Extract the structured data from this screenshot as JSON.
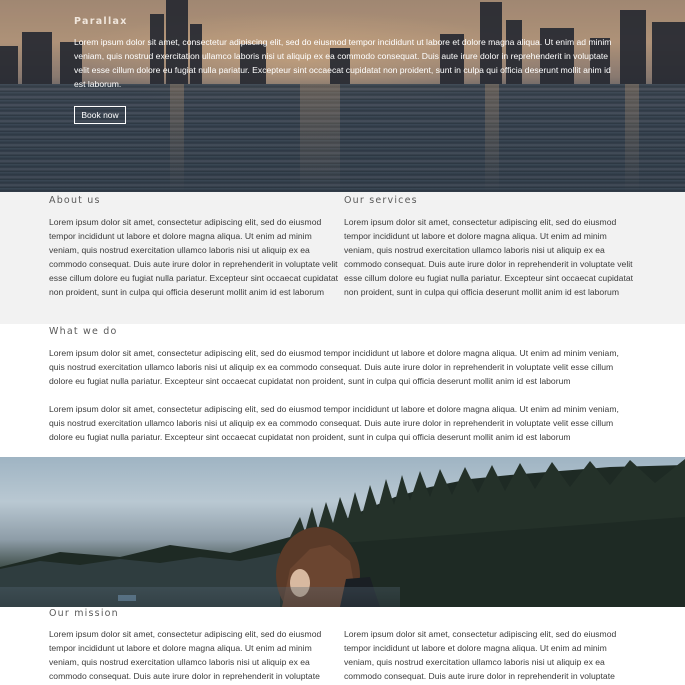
{
  "hero": {
    "title": "Parallax",
    "text": "Lorem ipsum dolor sit amet, consectetur adipiscing elit, sed do eiusmod tempor incididunt ut labore et dolore magna aliqua. Ut enim ad minim veniam, quis nostrud exercitation ullamco laboris nisi ut aliquip ex ea commodo consequat. Duis aute irure dolor in reprehenderit in voluptate velit esse cillum dolore eu fugiat nulla pariatur. Excepteur sint occaecat cupidatat non proident, sunt in culpa qui officia deserunt mollit anim id est laborum.",
    "button_label": "Book now"
  },
  "about": {
    "heading": "About us",
    "text": "Lorem ipsum dolor sit amet, consectetur adipiscing elit, sed do eiusmod tempor incididunt ut labore et dolore magna aliqua. Ut enim ad minim veniam, quis nostrud exercitation ullamco laboris nisi ut aliquip ex ea commodo consequat. Duis aute irure dolor in reprehenderit in voluptate velit esse cillum dolore eu fugiat nulla pariatur. Excepteur sint occaecat cupidatat non proident, sunt in culpa qui officia deserunt mollit anim id est laborum"
  },
  "services": {
    "heading": "Our services",
    "text": "Lorem ipsum dolor sit amet, consectetur adipiscing elit, sed do eiusmod tempor incididunt ut labore et dolore magna aliqua. Ut enim ad minim veniam, quis nostrud exercitation ullamco laboris nisi ut aliquip ex ea commodo consequat. Duis aute irure dolor in reprehenderit in voluptate velit esse cillum dolore eu fugiat nulla pariatur. Excepteur sint occaecat cupidatat non proident, sunt in culpa qui officia deserunt mollit anim id est laborum"
  },
  "what_we_do": {
    "heading": "What we do",
    "paragraphs": [
      "Lorem ipsum dolor sit amet, consectetur adipiscing elit, sed do eiusmod tempor incididunt ut labore et dolore magna aliqua. Ut enim ad minim veniam, quis nostrud exercitation ullamco laboris nisi ut aliquip ex ea commodo consequat. Duis aute irure dolor in reprehenderit in voluptate velit esse cillum dolore eu fugiat nulla pariatur. Excepteur sint occaecat cupidatat non proident, sunt in culpa qui officia deserunt mollit anim id est laborum",
      "Lorem ipsum dolor sit amet, consectetur adipiscing elit, sed do eiusmod tempor incididunt ut labore et dolore magna aliqua. Ut enim ad minim veniam, quis nostrud exercitation ullamco laboris nisi ut aliquip ex ea commodo consequat. Duis aute irure dolor in reprehenderit in voluptate velit esse cillum dolore eu fugiat nulla pariatur. Excepteur sint occaecat cupidatat non proident, sunt in culpa qui officia deserunt mollit anim id est laborum"
    ]
  },
  "mission": {
    "heading": "Our mission",
    "columns": [
      "Lorem ipsum dolor sit amet, consectetur adipiscing elit, sed do eiusmod tempor incididunt ut labore et dolore magna aliqua. Ut enim ad minim veniam, quis nostrud exercitation ullamco laboris nisi ut aliquip ex ea commodo consequat. Duis aute irure dolor in reprehenderit in voluptate",
      "Lorem ipsum dolor sit amet, consectetur adipiscing elit, sed do eiusmod tempor incididunt ut labore et dolore magna aliqua. Ut enim ad minim veniam, quis nostrud exercitation ullamco laboris nisi ut aliquip ex ea commodo consequat. Duis aute irure dolor in reprehenderit in voluptate"
    ]
  },
  "colors": {
    "section_background": "#f2f2f2",
    "text": "#3c3c3c",
    "heading": "#5a5a5a"
  }
}
